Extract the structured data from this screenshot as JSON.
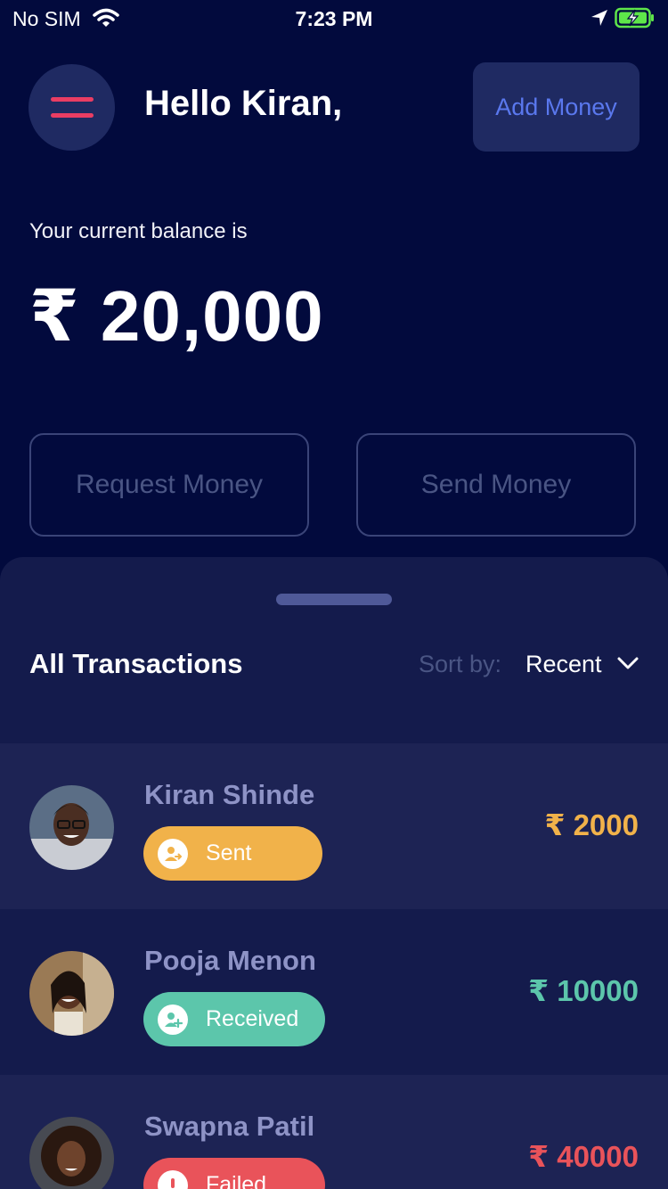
{
  "status_bar": {
    "carrier": "No SIM",
    "time": "7:23 PM",
    "icons": [
      "wifi-icon",
      "location-arrow-icon",
      "battery-charging-icon"
    ]
  },
  "header": {
    "menu_icon": "menu-icon",
    "greeting": "Hello Kiran,",
    "add_money_label": "Add Money"
  },
  "balance": {
    "label": "Your current balance is",
    "amount": "₹ 20,000"
  },
  "actions": {
    "request_label": "Request Money",
    "send_label": "Send Money"
  },
  "transactions": {
    "title": "All Transactions",
    "sort_label": "Sort by:",
    "sort_value": "Recent",
    "items": [
      {
        "name": "Kiran Shinde",
        "status": "Sent",
        "amount": "₹ 2000",
        "color": "#f1b24a",
        "icon": "user-send-icon"
      },
      {
        "name": "Pooja Menon",
        "status": "Received",
        "amount": "₹ 10000",
        "color": "#5cc6ab",
        "icon": "user-add-icon"
      },
      {
        "name": "Swapna Patil",
        "status": "Failed",
        "amount": "₹ 40000",
        "color": "#e9535a",
        "icon": "alert-icon"
      }
    ]
  },
  "colors": {
    "background": "#020a3d",
    "sheet": "#141b4c",
    "row_highlight": "#1d2354",
    "accent_red": "#ea3d63",
    "accent_blue": "#5a78ee",
    "sent": "#f1b24a",
    "received": "#5cc6ab",
    "failed": "#e9535a"
  }
}
